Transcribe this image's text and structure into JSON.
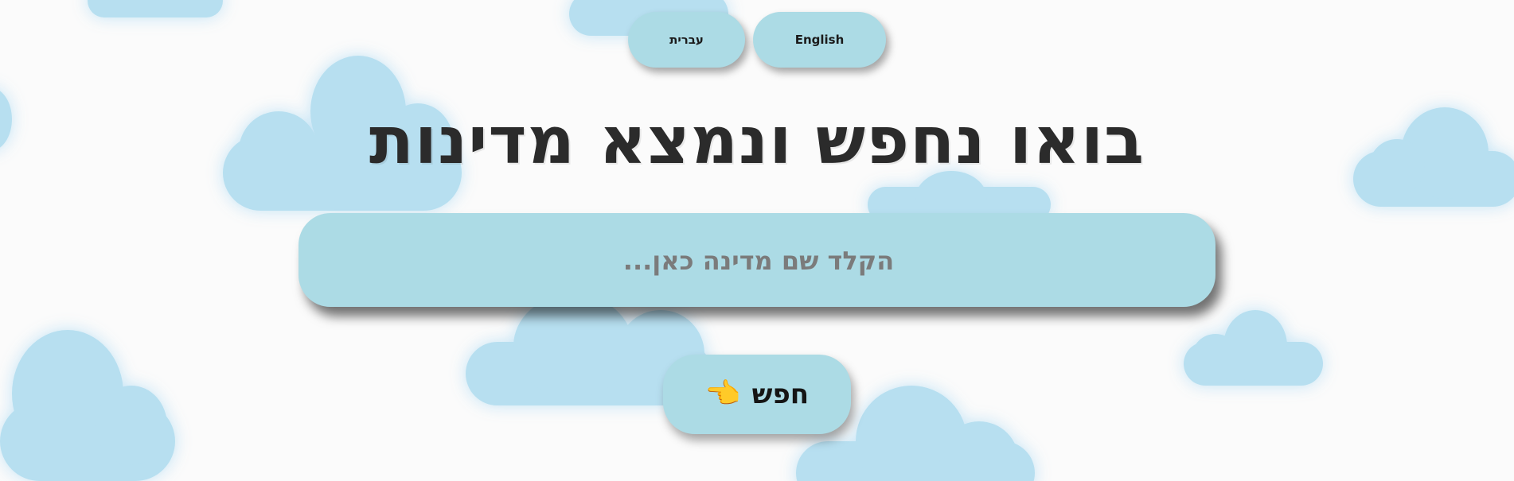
{
  "language_switcher": {
    "hebrew_label": "עברית",
    "english_label": "English"
  },
  "heading": {
    "title": "בואו נחפש ונמצא מדינות"
  },
  "search": {
    "placeholder": "הקלד שם מדינה כאן...",
    "value": ""
  },
  "search_button": {
    "label": "חפש",
    "icon": "pointing-hand-icon",
    "icon_glyph": "👈"
  },
  "colors": {
    "background": "#fbfbfb",
    "cloud": "#b7dff0",
    "button_fill": "#acdbe5",
    "title_text": "#2b2b2b",
    "placeholder_text": "#7b7b7b",
    "hand_icon": "#f7c12f"
  }
}
